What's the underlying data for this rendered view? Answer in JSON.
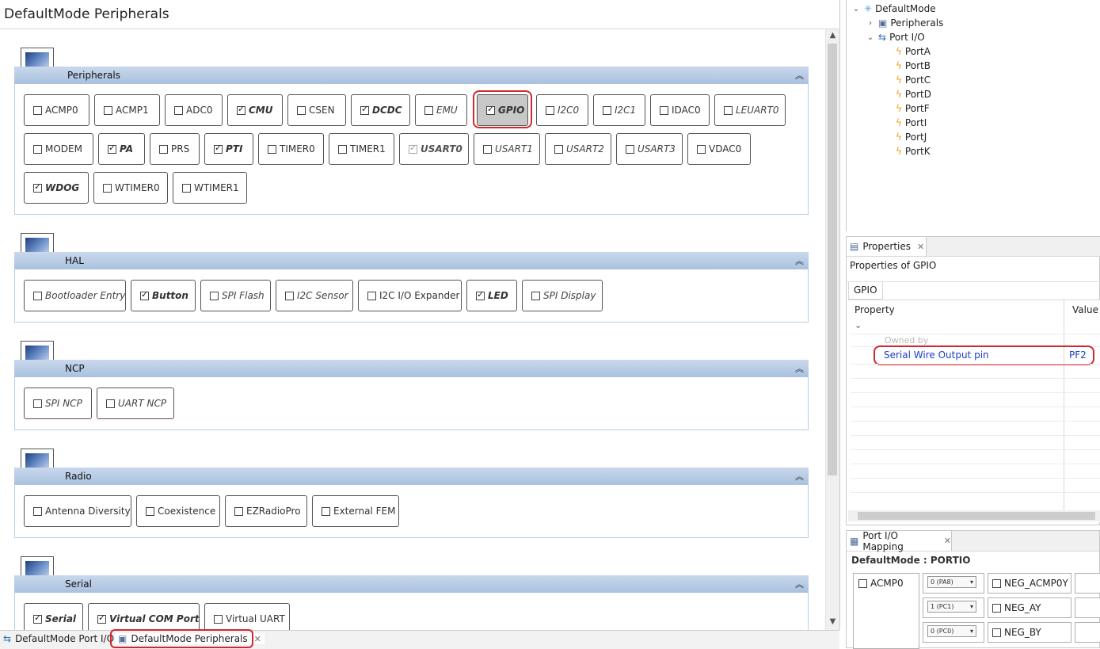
{
  "editor": {
    "title": "DefaultMode Peripherals",
    "sections": {
      "peripherals": {
        "label": "Peripherals",
        "items": {
          "acmp0": "ACMP0",
          "acmp1": "ACMP1",
          "adc0": "ADC0",
          "cmu": "CMU",
          "csen": "CSEN",
          "dcdc": "DCDC",
          "emu": "EMU",
          "gpio": "GPIO",
          "i2c0": "I2C0",
          "i2c1": "I2C1",
          "idac0": "IDAC0",
          "leuart0": "LEUART0",
          "modem": "MODEM",
          "pa": "PA",
          "prs": "PRS",
          "pti": "PTI",
          "timer0": "TIMER0",
          "timer1": "TIMER1",
          "usart0": "USART0",
          "usart1": "USART1",
          "usart2": "USART2",
          "usart3": "USART3",
          "vdac0": "VDAC0",
          "wdog": "WDOG",
          "wtimer0": "WTIMER0",
          "wtimer1": "WTIMER1"
        }
      },
      "hal": {
        "label": "HAL",
        "items": {
          "bootloader_entry": "Bootloader Entry",
          "button": "Button",
          "spi_flash": "SPI Flash",
          "i2c_sensor": "I2C Sensor",
          "i2c_io_expander": "I2C I/O Expander",
          "led": "LED",
          "spi_display": "SPI Display"
        }
      },
      "ncp": {
        "label": "NCP",
        "items": {
          "spi_ncp": "SPI NCP",
          "uart_ncp": "UART NCP"
        }
      },
      "radio": {
        "label": "Radio",
        "items": {
          "antenna_diversity": "Antenna Diversity",
          "coexistence": "Coexistence",
          "ezradiopro": "EZRadioPro",
          "external_fem": "External FEM"
        }
      },
      "serial": {
        "label": "Serial",
        "items": {
          "serial": "Serial",
          "virtual_com_port": "Virtual COM Port",
          "virtual_uart": "Virtual UART"
        }
      }
    },
    "checked": [
      "CMU",
      "DCDC",
      "GPIO",
      "PA",
      "PTI",
      "USART0",
      "WDOG",
      "Button",
      "LED",
      "Serial",
      "Virtual COM Port"
    ]
  },
  "bottom_tabs": {
    "port_io": "DefaultMode Port I/O",
    "peripherals": "DefaultMode Peripherals"
  },
  "outline": {
    "root": "DefaultMode",
    "peripherals": "Peripherals",
    "port_io": "Port I/O",
    "ports": [
      "PortA",
      "PortB",
      "PortC",
      "PortD",
      "PortF",
      "PortI",
      "PortJ",
      "PortK"
    ]
  },
  "properties": {
    "tab_label": "Properties",
    "heading": "Properties of GPIO",
    "subtab": "GPIO",
    "col_property": "Property",
    "col_value": "Value",
    "group_label": "Owned by",
    "row_name": "Serial Wire Output pin",
    "row_value": "PF2"
  },
  "port_io_mapping": {
    "tab_label": "Port I/O Mapping",
    "heading": "DefaultMode : PORTIO",
    "module": "ACMP0",
    "rows": [
      {
        "select": "0 (PA8)",
        "signal": "NEG_ACMP0Y"
      },
      {
        "select": "1 (PC1)",
        "signal": "NEG_AY"
      },
      {
        "select": "0 (PC0)",
        "signal": "NEG_BY"
      }
    ]
  },
  "colors": {
    "accent_red": "#d4262e",
    "section_bar": "#b5cae4",
    "link_blue": "#1a3fc4"
  }
}
